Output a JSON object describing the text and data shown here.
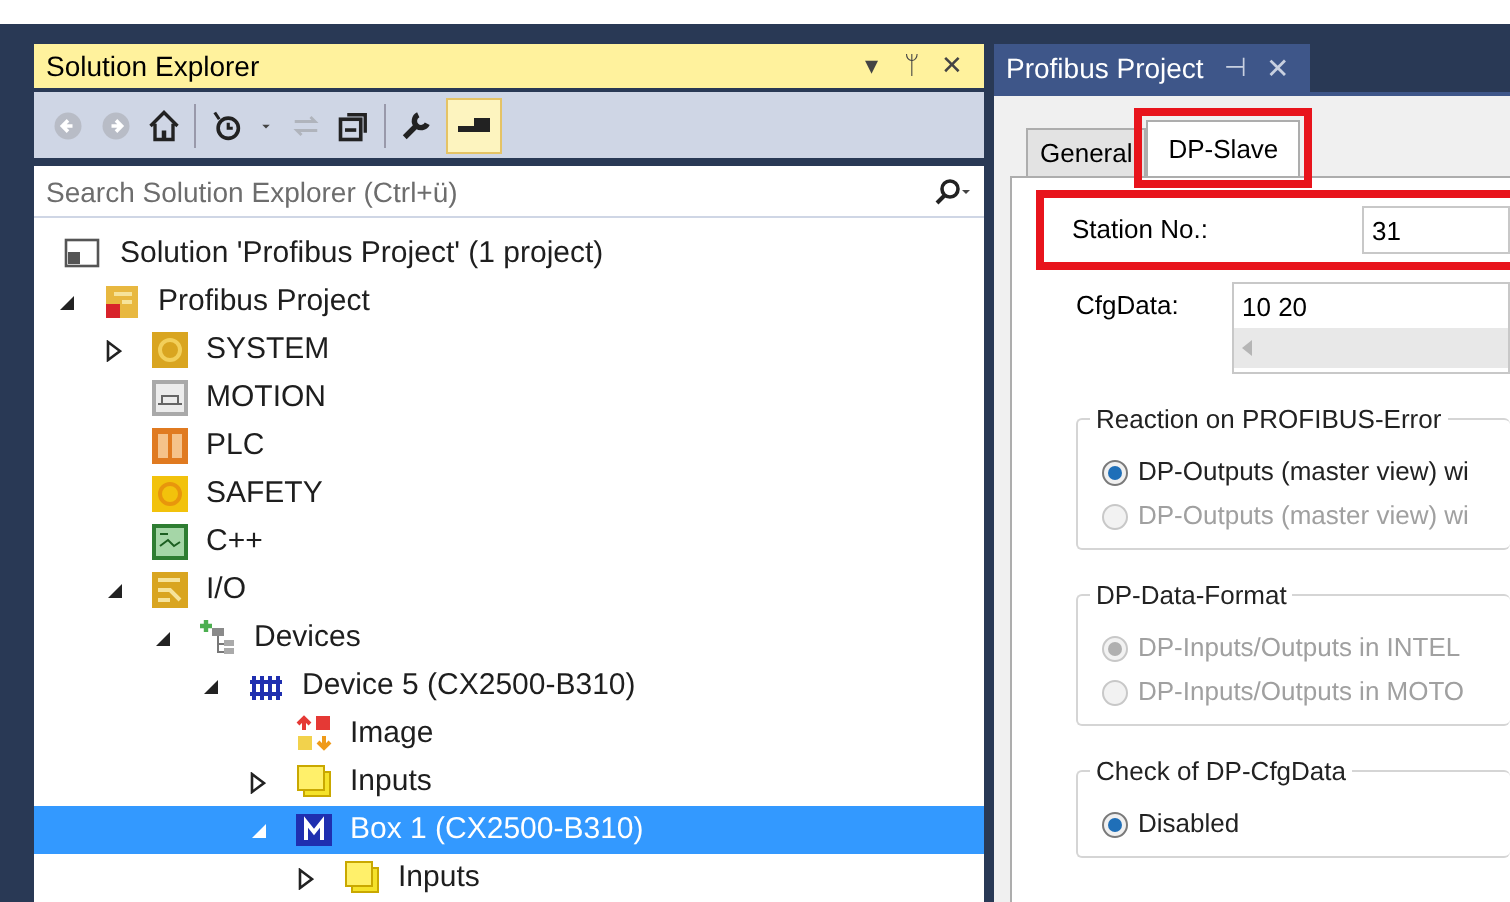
{
  "solution_explorer": {
    "title": "Solution Explorer",
    "title_buttons": [
      "▾",
      "ᛘ",
      "✕"
    ],
    "search": {
      "placeholder": "Search Solution Explorer (Ctrl+ü)"
    },
    "tree": [
      {
        "label": "Solution 'Profibus Project' (1 project)",
        "kind": "solution",
        "selected": false,
        "children": [
          {
            "label": "Profibus Project",
            "kind": "project",
            "expanded": true,
            "selected": false,
            "children": [
              {
                "label": "SYSTEM",
                "kind": "system",
                "expanded": false,
                "selected": false
              },
              {
                "label": "MOTION",
                "kind": "motion",
                "selected": false
              },
              {
                "label": "PLC",
                "kind": "plc",
                "selected": false
              },
              {
                "label": "SAFETY",
                "kind": "safety",
                "selected": false
              },
              {
                "label": "C++",
                "kind": "cpp",
                "selected": false
              },
              {
                "label": "I/O",
                "kind": "io",
                "expanded": true,
                "selected": false,
                "children": [
                  {
                    "label": "Devices",
                    "kind": "devices",
                    "expanded": true,
                    "selected": false,
                    "children": [
                      {
                        "label": "Device 5 (CX2500-B310)",
                        "kind": "device",
                        "expanded": true,
                        "selected": false,
                        "children": [
                          {
                            "label": "Image",
                            "kind": "image",
                            "selected": false
                          },
                          {
                            "label": "Inputs",
                            "kind": "inputs",
                            "expanded": false,
                            "selected": false
                          },
                          {
                            "label": "Box 1 (CX2500-B310)",
                            "kind": "box",
                            "expanded": true,
                            "selected": true,
                            "children": [
                              {
                                "label": "Inputs",
                                "kind": "inputs",
                                "expanded": false,
                                "selected": false
                              }
                            ]
                          }
                        ]
                      }
                    ]
                  }
                ]
              }
            ]
          }
        ]
      }
    ]
  },
  "document": {
    "tab": {
      "title": "Profibus Project",
      "pin": "⊣",
      "close": "✕"
    },
    "tabs": [
      {
        "label": "General",
        "selected": false,
        "highlighted": false
      },
      {
        "label": "DP-Slave",
        "selected": true,
        "highlighted": true
      }
    ],
    "station_no": {
      "label": "Station No.:",
      "value": "31",
      "highlighted": true
    },
    "cfg_data": {
      "label": "CfgData:",
      "value": "10 20"
    },
    "groups": [
      {
        "title": "Reaction on PROFIBUS-Error",
        "options": [
          {
            "label": "DP-Outputs (master view) wi",
            "selected": true,
            "disabled": false
          },
          {
            "label": "DP-Outputs (master view) wi",
            "selected": false,
            "disabled": true
          }
        ]
      },
      {
        "title": "DP-Data-Format",
        "options": [
          {
            "label": "DP-Inputs/Outputs in INTEL",
            "selected": true,
            "disabled": true
          },
          {
            "label": "DP-Inputs/Outputs in MOTO",
            "selected": false,
            "disabled": true
          }
        ]
      },
      {
        "title": "Check of DP-CfgData",
        "options": [
          {
            "label": "Disabled",
            "selected": true,
            "disabled": false
          }
        ]
      }
    ]
  }
}
